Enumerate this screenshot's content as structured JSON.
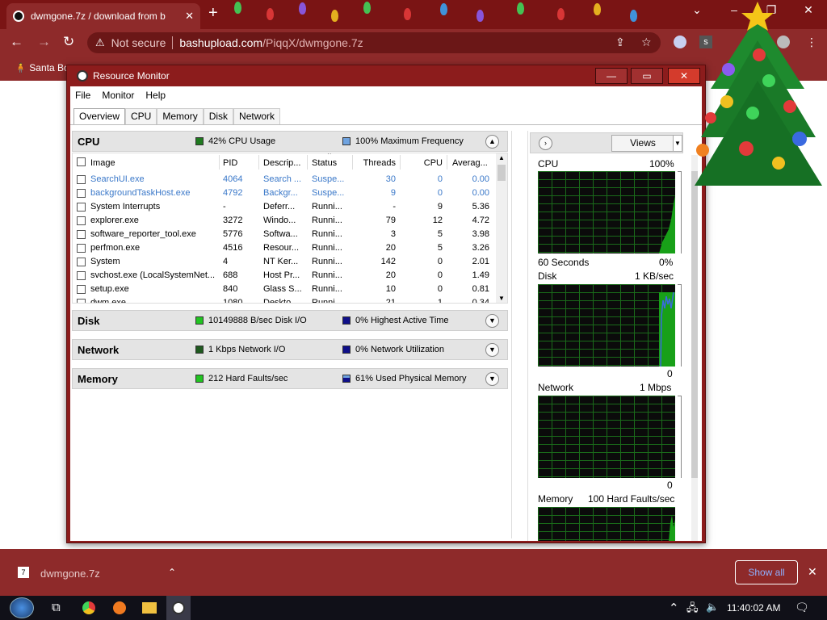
{
  "browser": {
    "tab_title": "dwmgone.7z / download from b",
    "tab_close": "✕",
    "newtab": "+",
    "not_secure": "Not secure",
    "url_host": "bashupload.com",
    "url_path": "/PiqqX/dwmgone.7z",
    "bookmark": "Santa Bo",
    "extension_letter": "s"
  },
  "resmon": {
    "title": "Resource Monitor",
    "menu": [
      "File",
      "Monitor",
      "Help"
    ],
    "tabs": [
      "Overview",
      "CPU",
      "Memory",
      "Disk",
      "Network"
    ],
    "cpu": {
      "name": "CPU",
      "stat1": "42% CPU Usage",
      "stat2": "100% Maximum Frequency",
      "columns": [
        "Image",
        "PID",
        "Descrip...",
        "Status",
        "Threads",
        "CPU",
        "Averag..."
      ],
      "rows": [
        {
          "image": "SearchUI.exe",
          "pid": "4064",
          "desc": "Search ...",
          "status": "Suspe...",
          "threads": "30",
          "cpu": "0",
          "avg": "0.00",
          "blue": true
        },
        {
          "image": "backgroundTaskHost.exe",
          "pid": "4792",
          "desc": "Backgr...",
          "status": "Suspe...",
          "threads": "9",
          "cpu": "0",
          "avg": "0.00",
          "blue": true
        },
        {
          "image": "System Interrupts",
          "pid": "-",
          "desc": "Deferr...",
          "status": "Runni...",
          "threads": "-",
          "cpu": "9",
          "avg": "5.36",
          "blue": false
        },
        {
          "image": "explorer.exe",
          "pid": "3272",
          "desc": "Windo...",
          "status": "Runni...",
          "threads": "79",
          "cpu": "12",
          "avg": "4.72",
          "blue": false
        },
        {
          "image": "software_reporter_tool.exe",
          "pid": "5776",
          "desc": "Softwa...",
          "status": "Runni...",
          "threads": "3",
          "cpu": "5",
          "avg": "3.98",
          "blue": false
        },
        {
          "image": "perfmon.exe",
          "pid": "4516",
          "desc": "Resour...",
          "status": "Runni...",
          "threads": "20",
          "cpu": "5",
          "avg": "3.26",
          "blue": false
        },
        {
          "image": "System",
          "pid": "4",
          "desc": "NT Ker...",
          "status": "Runni...",
          "threads": "142",
          "cpu": "0",
          "avg": "2.01",
          "blue": false
        },
        {
          "image": "svchost.exe (LocalSystemNet...",
          "pid": "688",
          "desc": "Host Pr...",
          "status": "Runni...",
          "threads": "20",
          "cpu": "0",
          "avg": "1.49",
          "blue": false
        },
        {
          "image": "setup.exe",
          "pid": "840",
          "desc": "Glass S...",
          "status": "Runni...",
          "threads": "10",
          "cpu": "0",
          "avg": "0.81",
          "blue": false
        },
        {
          "image": "dwm.exe",
          "pid": "1080",
          "desc": "Deskto...",
          "status": "Runni...",
          "threads": "21",
          "cpu": "1",
          "avg": "0.34",
          "blue": false
        }
      ]
    },
    "disk": {
      "name": "Disk",
      "stat1": "10149888 B/sec Disk I/O",
      "stat2": "0% Highest Active Time"
    },
    "network": {
      "name": "Network",
      "stat1": "1 Kbps Network I/O",
      "stat2": "0% Network Utilization"
    },
    "memory": {
      "name": "Memory",
      "stat1": "212 Hard Faults/sec",
      "stat2": "61% Used Physical Memory"
    },
    "right": {
      "views_label": "Views",
      "graphs": [
        {
          "name": "CPU",
          "max": "100%",
          "foot_left": "60 Seconds",
          "foot_right": "0%"
        },
        {
          "name": "Disk",
          "max": "1 KB/sec",
          "foot_left": "",
          "foot_right": "0"
        },
        {
          "name": "Network",
          "max": "1 Mbps",
          "foot_left": "",
          "foot_right": "0"
        },
        {
          "name": "Memory",
          "max": "100 Hard Faults/sec",
          "foot_left": "",
          "foot_right": ""
        }
      ]
    }
  },
  "download": {
    "filename": "dwmgone.7z",
    "show_all": "Show all"
  },
  "taskbar": {
    "clock": "11:40:02 AM"
  },
  "colors": {
    "cpu_green": "#1f7a1f",
    "freq_blue": "#6fa3e0",
    "disk_green": "#22c422",
    "dark_blue": "#10108a",
    "graph_green": "#18a018"
  }
}
